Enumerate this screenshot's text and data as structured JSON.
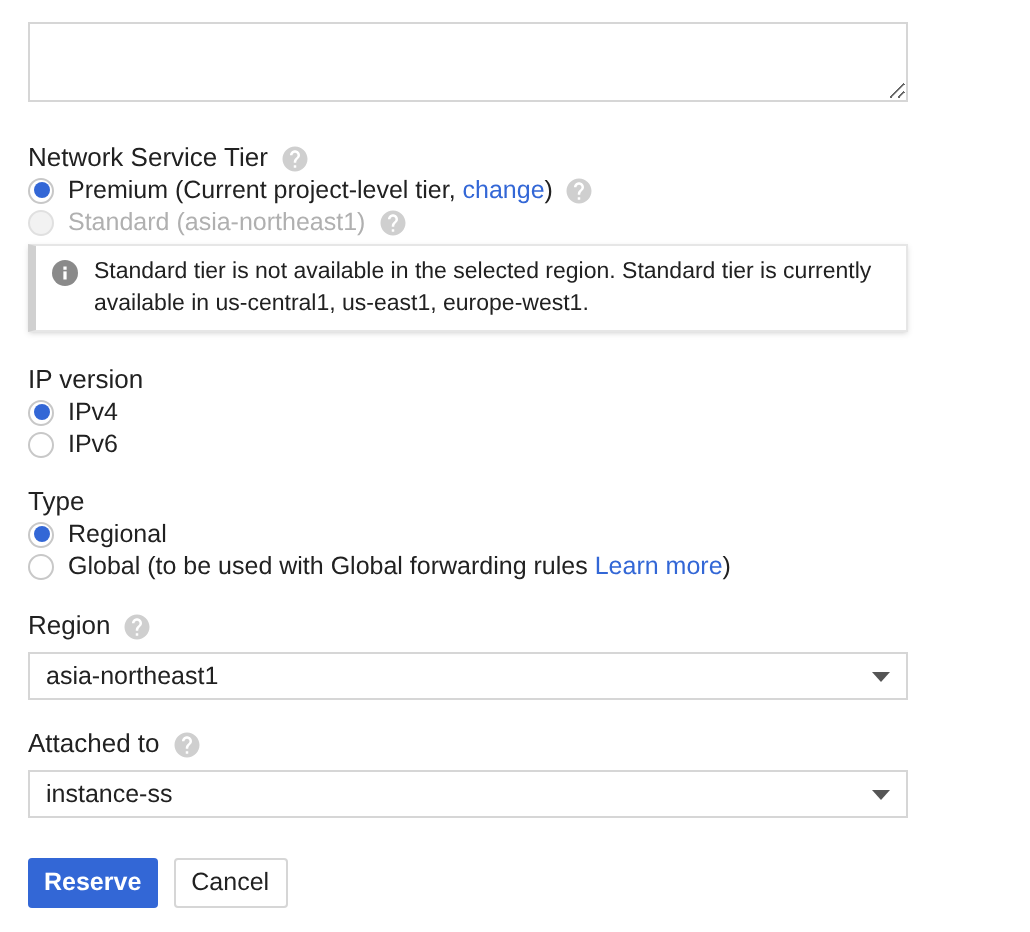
{
  "description_field": {
    "disabled": false
  },
  "network_tier": {
    "title": "Network Service Tier",
    "help": true,
    "options": [
      {
        "label": "Premium (Current project-level tier, ",
        "link": "change",
        "suffix": ")",
        "selected": true,
        "disabled": false,
        "help": true
      },
      {
        "label": "Standard (asia-northeast1)",
        "selected": false,
        "disabled": true,
        "help": true
      }
    ],
    "notice": "Standard tier is not available in the selected region. Standard tier is currently available in us-central1, us-east1, europe-west1."
  },
  "ip_version": {
    "title": "IP version",
    "help": false,
    "options": [
      {
        "label": "IPv4",
        "selected": true,
        "disabled": false,
        "help": false
      },
      {
        "label": "IPv6",
        "selected": false,
        "disabled": false,
        "help": false
      }
    ]
  },
  "type": {
    "title": "Type",
    "help": false,
    "options": [
      {
        "label": "Regional",
        "selected": true,
        "disabled": false,
        "help": false
      },
      {
        "label": "Global (to be used with Global forwarding rules ",
        "link": "Learn more",
        "suffix": ")",
        "selected": false,
        "disabled": false,
        "help": false
      }
    ]
  },
  "region": {
    "title": "Region",
    "help": true,
    "value": "asia-northeast1"
  },
  "attached_to": {
    "title": "Attached to",
    "help": true,
    "value": "instance-ss"
  },
  "buttons": [
    {
      "label": "Reserve",
      "kind": "primary"
    },
    {
      "label": "Cancel",
      "kind": "secondary"
    }
  ]
}
